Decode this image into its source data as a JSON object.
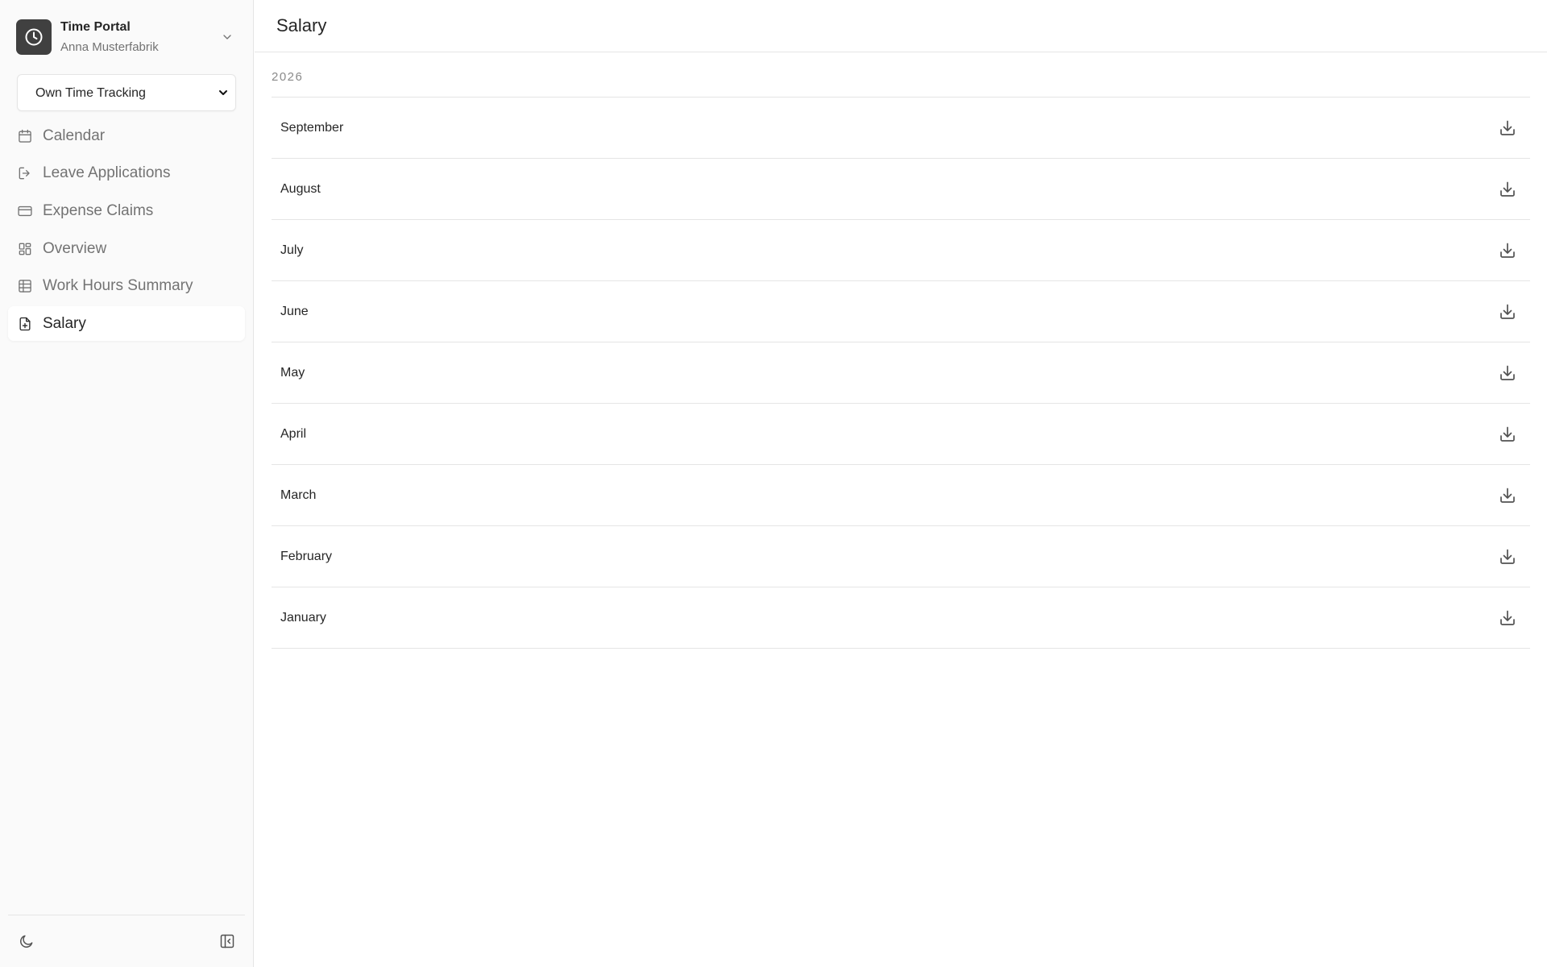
{
  "app": {
    "title": "Time Portal",
    "user": "Anna Musterfabrik"
  },
  "mode_select": {
    "selected": "Own Time Tracking",
    "options": [
      "Own Time Tracking"
    ]
  },
  "nav": [
    {
      "id": "calendar",
      "label": "Calendar",
      "icon": "calendar-icon",
      "active": false
    },
    {
      "id": "leave-applications",
      "label": "Leave Applications",
      "icon": "log-out-icon",
      "active": false
    },
    {
      "id": "expense-claims",
      "label": "Expense Claims",
      "icon": "credit-card-icon",
      "active": false
    },
    {
      "id": "overview",
      "label": "Overview",
      "icon": "dashboard-icon",
      "active": false
    },
    {
      "id": "work-hours-summary",
      "label": "Work Hours Summary",
      "icon": "table-icon",
      "active": false
    },
    {
      "id": "salary",
      "label": "Salary",
      "icon": "file-plus-icon",
      "active": true
    }
  ],
  "page": {
    "title": "Salary"
  },
  "salary": {
    "year": "2026",
    "months": [
      "September",
      "August",
      "July",
      "June",
      "May",
      "April",
      "March",
      "February",
      "January"
    ]
  },
  "colors": {
    "sidebar_bg": "#fafafa",
    "logo_bg": "#404040",
    "border": "#e5e5e5",
    "text": "#262626",
    "muted": "#737373"
  }
}
